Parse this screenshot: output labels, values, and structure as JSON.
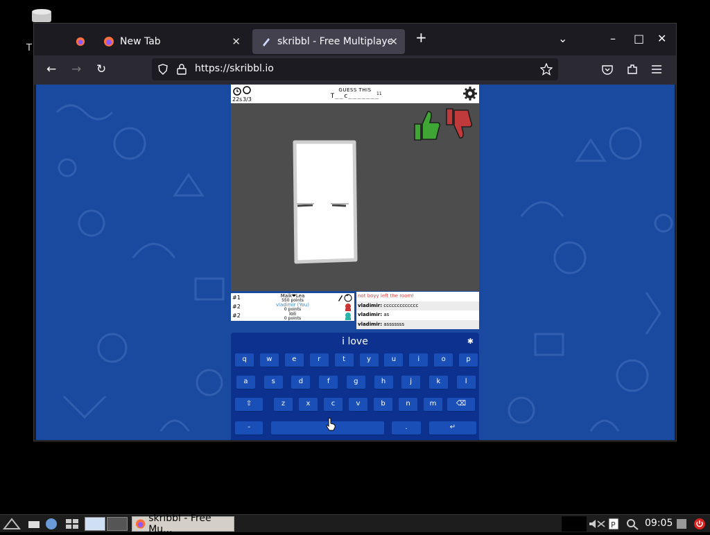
{
  "desktop": {
    "stray_letter": "T"
  },
  "browser": {
    "tabs": [
      {
        "label": "",
        "icon": "firefox-icon"
      },
      {
        "label": "New Tab",
        "icon": "firefox-icon"
      },
      {
        "label": "skribbl - Free Multiplayer",
        "icon": "pencil-icon",
        "active": true
      }
    ],
    "new_tab": "+",
    "list_all_tabs": "⌄",
    "window_controls": {
      "minimize": "–",
      "maximize": "□",
      "close": "✕"
    },
    "nav": {
      "back": "←",
      "forward": "→",
      "reload": "↻"
    },
    "url": "https://skribbl.io"
  },
  "game": {
    "timer": "22s",
    "round": "3/3",
    "guess_label": "GUESS THIS",
    "word_hint": "T__c_______",
    "letter_count": "11",
    "vote": {
      "like_color": "#3fa534",
      "dislike_color": "#c0393b"
    },
    "players": [
      {
        "rank": "#1",
        "name": "Maik❤Lea",
        "points": "550 points"
      },
      {
        "rank": "#2",
        "name": "vladimir (You)",
        "points": "0 points",
        "you": true
      },
      {
        "rank": "#2",
        "name": "loli",
        "points": "0 points"
      }
    ],
    "chat": [
      {
        "who": "",
        "text": "not boyy left the room!",
        "system": true
      },
      {
        "who": "vladimir:",
        "text": " ccccccccccccc"
      },
      {
        "who": "vladimir:",
        "text": " as"
      },
      {
        "who": "vladimir:",
        "text": " asssssss"
      }
    ]
  },
  "keyboard": {
    "input_value": "i love",
    "row1": [
      "q",
      "w",
      "e",
      "r",
      "t",
      "y",
      "u",
      "i",
      "o",
      "p"
    ],
    "row2": [
      "a",
      "s",
      "d",
      "f",
      "g",
      "h",
      "j",
      "k",
      "l"
    ],
    "row3": [
      "⇧",
      "z",
      "x",
      "c",
      "v",
      "b",
      "n",
      "m",
      "⌫"
    ],
    "row4": {
      "dash": "-",
      "space": "",
      "dot": ".",
      "enter": "↵"
    }
  },
  "taskbar": {
    "app_label": "skribbl - Free Mu...",
    "clock": "09:05"
  }
}
